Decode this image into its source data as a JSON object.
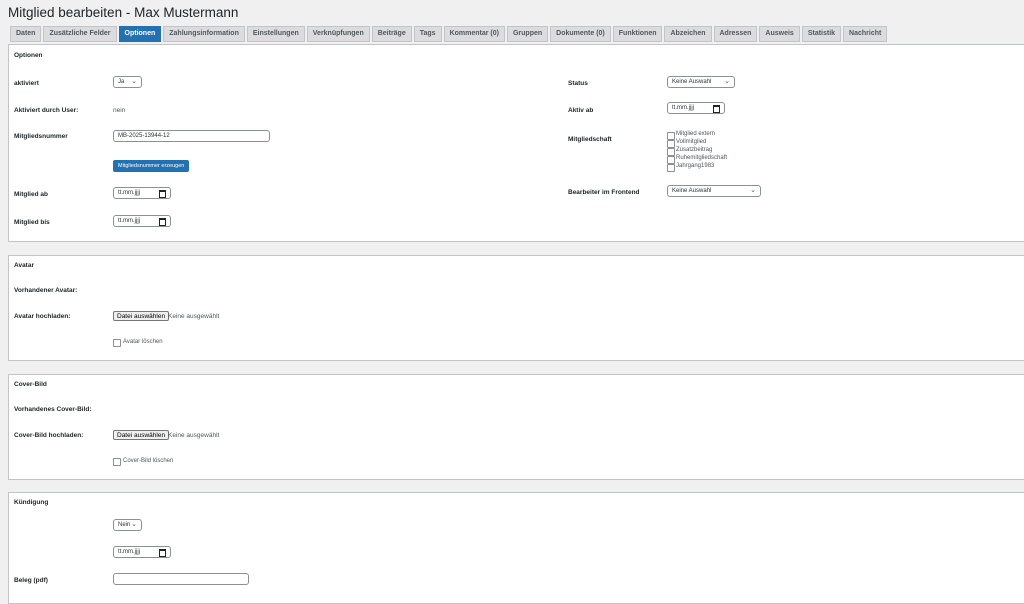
{
  "page": {
    "title": "Mitglied bearbeiten - Max Mustermann"
  },
  "tabs": [
    {
      "label": "Daten",
      "active": false
    },
    {
      "label": "Zusätzliche Felder",
      "active": false
    },
    {
      "label": "Optionen",
      "active": true
    },
    {
      "label": "Zahlungsinformation",
      "active": false
    },
    {
      "label": "Einstellungen",
      "active": false
    },
    {
      "label": "Verknüpfungen",
      "active": false
    },
    {
      "label": "Beiträge",
      "active": false
    },
    {
      "label": "Tags",
      "active": false
    },
    {
      "label": "Kommentar (0)",
      "active": false
    },
    {
      "label": "Gruppen",
      "active": false
    },
    {
      "label": "Dokumente (0)",
      "active": false
    },
    {
      "label": "Funktionen",
      "active": false
    },
    {
      "label": "Abzeichen",
      "active": false
    },
    {
      "label": "Adressen",
      "active": false
    },
    {
      "label": "Ausweis",
      "active": false
    },
    {
      "label": "Statistik",
      "active": false
    },
    {
      "label": "Nachricht",
      "active": false
    }
  ],
  "options": {
    "title": "Optionen",
    "aktiviert": {
      "label": "aktiviert",
      "value": "Ja"
    },
    "aktiviert_durch_user": {
      "label": "Aktiviert durch User:",
      "value": "nein"
    },
    "mitgliedsnummer": {
      "label": "Mitgliedsnummer",
      "value": "MB-2025-13944-12",
      "button": "Mitgliedsnummer erzeugen"
    },
    "mitglied_ab": {
      "label": "Mitglied ab",
      "value": "tt.mm.jjjj"
    },
    "mitglied_bis": {
      "label": "Mitglied bis",
      "value": "tt.mm.jjjj"
    },
    "status": {
      "label": "Status",
      "value": "Keine Auswahl"
    },
    "aktiv_ab": {
      "label": "Aktiv ab",
      "value": "tt.mm.jjjj"
    },
    "mitgliedschaft": {
      "label": "Mitgliedschaft",
      "items": [
        "Mitglied extern",
        "Vollmitglied",
        "Zusatzbeitrag",
        "Ruhemitgliedschaft",
        "Jahrgang1983"
      ]
    },
    "bearbeiter": {
      "label": "Bearbeiter im Frontend",
      "value": "Keine Auswahl"
    }
  },
  "avatar": {
    "title": "Avatar",
    "existing_label": "Vorhandener Avatar:",
    "upload_label": "Avatar hochladen:",
    "file_button": "Datei auswählen",
    "file_status": "Keine ausgewählt",
    "delete_label": "Avatar löschen"
  },
  "cover": {
    "title": "Cover-Bild",
    "existing_label": "Vorhandenes Cover-Bild:",
    "upload_label": "Cover-Bild hochladen:",
    "file_button": "Datei auswählen",
    "file_status": "Keine ausgewählt",
    "delete_label": "Cover-Bild löschen"
  },
  "kuendigung": {
    "title": "Kündigung",
    "select_value": "Nein",
    "date_value": "tt.mm.jjjj",
    "beleg_label": "Beleg (pdf)",
    "beleg_value": ""
  },
  "icons": {
    "chevron": "chevron-down-icon",
    "calendar": "calendar-icon"
  },
  "colors": {
    "accent": "#2271b1",
    "background": "#f0f0f1"
  }
}
